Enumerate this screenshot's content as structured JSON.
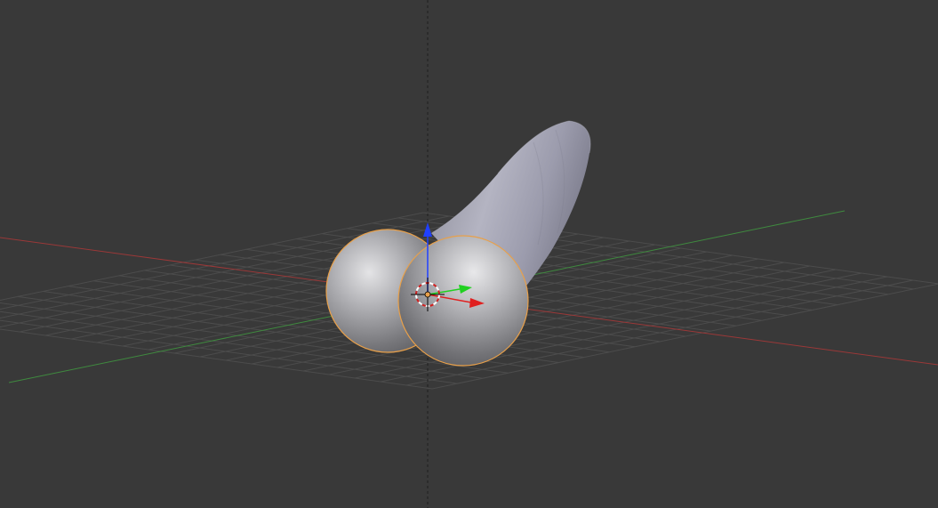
{
  "viewport": {
    "view": "3D Viewport",
    "background_color": "#393939",
    "grid_color": "#4c4c4c",
    "x_axis_color": "#a33a3a",
    "y_axis_color": "#3c8f3c",
    "z_axis_color": "#1f1f1f",
    "selection_outline_color": "#e8a04a",
    "mesh_color": "#a8a8b0"
  },
  "objects": [
    {
      "name": "tube-mesh",
      "selected": false
    },
    {
      "name": "left-sphere",
      "selected": true
    },
    {
      "name": "right-sphere",
      "selected": true
    }
  ],
  "gizmo": {
    "x_handle_color": "#e02020",
    "y_handle_color": "#20d020",
    "z_handle_color": "#2040ff",
    "icons": [
      "3d-cursor-icon",
      "transform-gizmo-icon"
    ]
  }
}
